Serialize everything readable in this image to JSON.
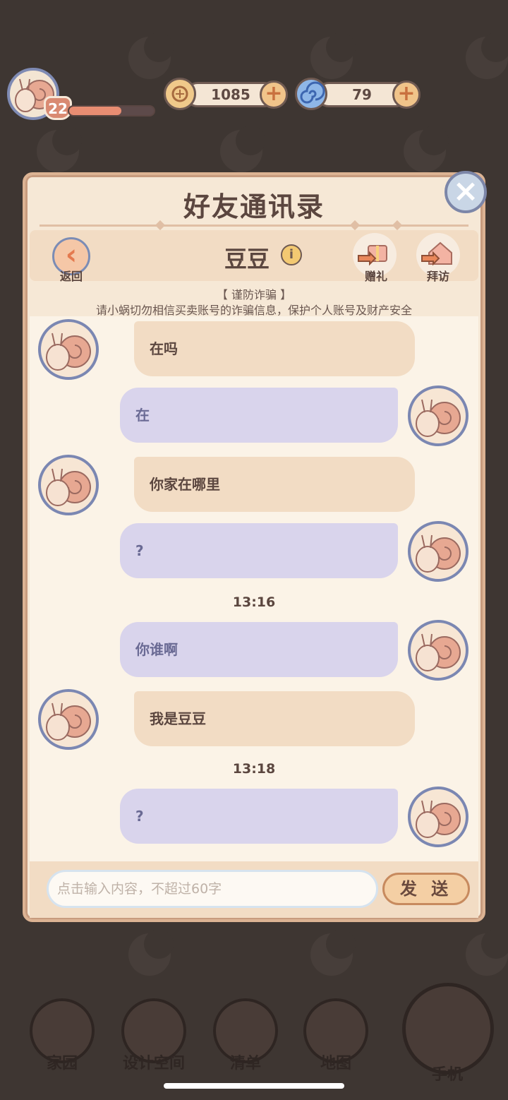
{
  "hud": {
    "level": "22",
    "xp_progress_pct": 62,
    "coins": "1085",
    "gems": "79",
    "coin_icon": "leaf-coin-icon",
    "gem_icon": "swirl-gem-icon"
  },
  "modal": {
    "title": "好友通讯录",
    "back_label": "返回",
    "friend_name": "豆豆",
    "gift_label": "赠礼",
    "visit_label": "拜访",
    "warning_title": "【 谨防诈骗 】",
    "warning_text": "请小蜗切勿相信买卖账号的诈骗信息，保护个人账号及财产安全",
    "input_placeholder": "点击输入内容，不超过60字",
    "send_label": "发 送"
  },
  "messages": [
    {
      "side": "in",
      "text": "在吗"
    },
    {
      "side": "out",
      "text": "在"
    },
    {
      "side": "in",
      "text": "你家在哪里"
    },
    {
      "side": "out",
      "text": "?"
    },
    {
      "time": "13:16"
    },
    {
      "side": "out",
      "text": "你谁啊"
    },
    {
      "side": "in",
      "text": "我是豆豆"
    },
    {
      "time": "13:18"
    },
    {
      "side": "out",
      "text": "?"
    }
  ],
  "nav": {
    "home": "家园",
    "design": "设计空间",
    "list": "清单",
    "map": "地图",
    "phone": "手机"
  },
  "colors": {
    "incoming_bubble": "#f2dcc4",
    "outgoing_bubble": "#d9d4ec",
    "modal_bg": "#f6e8d6",
    "accent": "#e88d72"
  }
}
